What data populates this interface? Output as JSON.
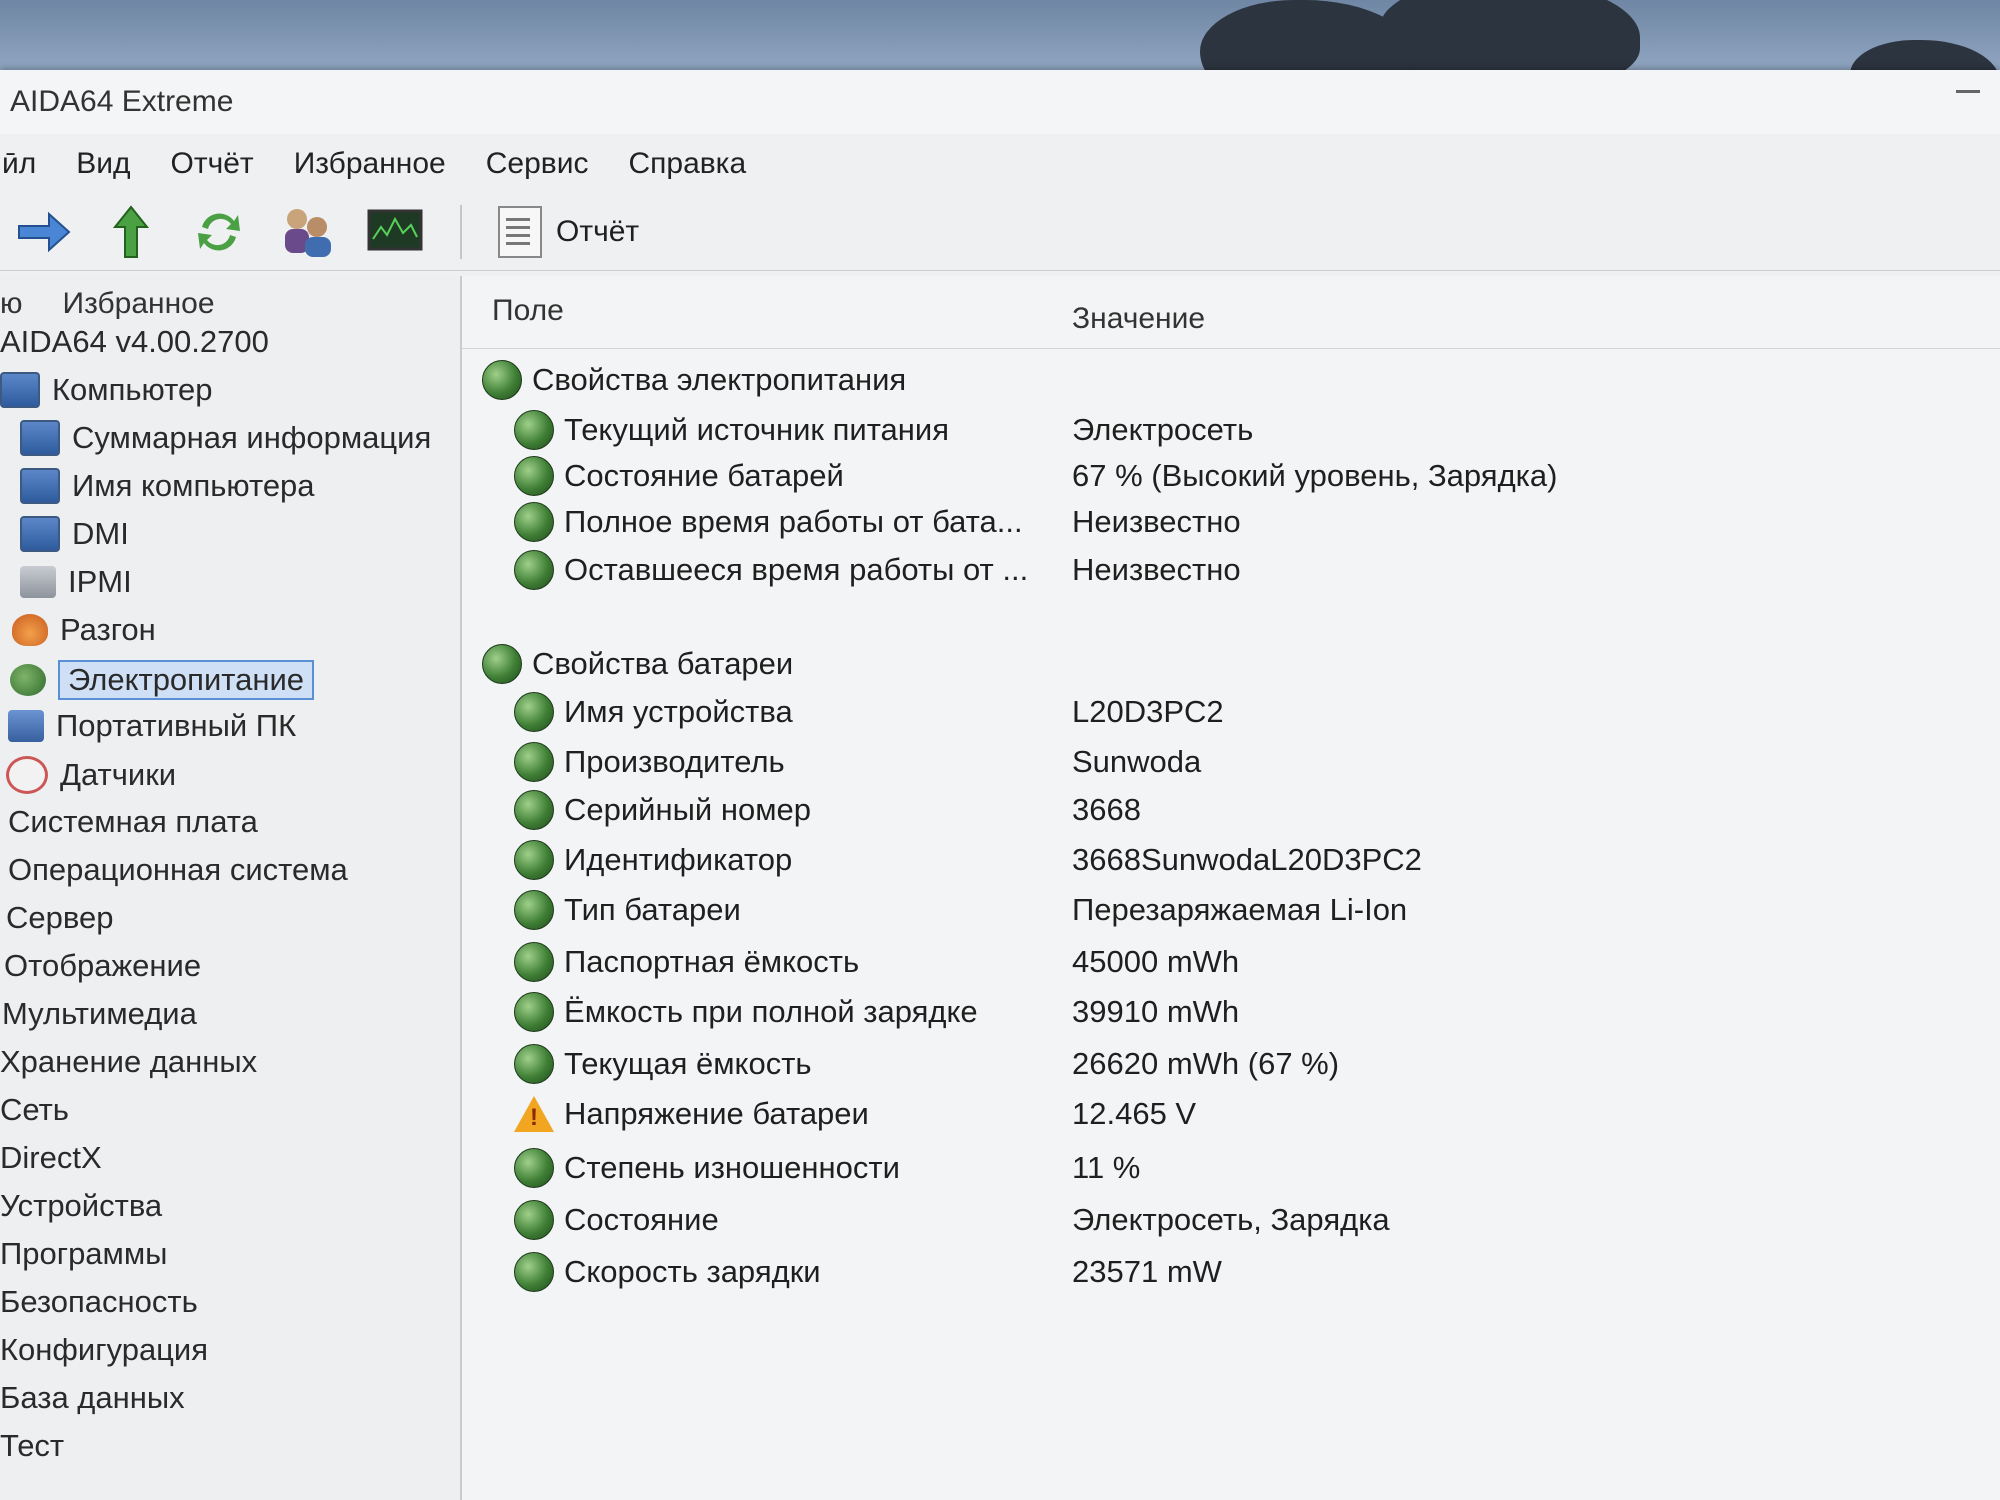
{
  "window": {
    "title": "AIDA64 Extreme"
  },
  "menu": [
    "ӣл",
    "Вид",
    "Отчёт",
    "Избранное",
    "Сервис",
    "Справка"
  ],
  "toolbar": {
    "buttons": [
      "arrow-right-icon",
      "arrow-up-icon",
      "refresh-icon",
      "users-icon",
      "monitor-icon"
    ],
    "report_label": "Отчёт"
  },
  "left_pane": {
    "tabs": [
      "ю",
      "Избранное"
    ],
    "items": [
      {
        "label": "AIDA64 v4.00.2700",
        "icon": ""
      },
      {
        "label": "Компьютер",
        "icon": "monitor"
      },
      {
        "label": "Суммарная информация",
        "icon": "monitor"
      },
      {
        "label": "Имя компьютера",
        "icon": "monitor"
      },
      {
        "label": "DMI",
        "icon": "monitor"
      },
      {
        "label": "IPMI",
        "icon": "server"
      },
      {
        "label": "Разгон",
        "icon": "fire"
      },
      {
        "label": "Электропитание",
        "icon": "power",
        "selected": true
      },
      {
        "label": "Портативный ПК",
        "icon": "laptop"
      },
      {
        "label": "Датчики",
        "icon": "gauge"
      },
      {
        "label": "Системная плата",
        "icon": ""
      },
      {
        "label": "Операционная система",
        "icon": ""
      },
      {
        "label": "Сервер",
        "icon": ""
      },
      {
        "label": "Отображение",
        "icon": ""
      },
      {
        "label": "Мультимедиа",
        "icon": ""
      },
      {
        "label": "Хранение данных",
        "icon": ""
      },
      {
        "label": "Сеть",
        "icon": ""
      },
      {
        "label": "DirectX",
        "icon": ""
      },
      {
        "label": "Устройства",
        "icon": ""
      },
      {
        "label": "Программы",
        "icon": ""
      },
      {
        "label": "Безопасность",
        "icon": ""
      },
      {
        "label": "Конфигурация",
        "icon": ""
      },
      {
        "label": "База данных",
        "icon": ""
      },
      {
        "label": "Тест",
        "icon": ""
      }
    ]
  },
  "table": {
    "columns": [
      "Поле",
      "Значение"
    ],
    "rows": [
      {
        "field": "Свойства электропитания",
        "value": "",
        "icon": "power",
        "group": true
      },
      {
        "field": "Текущий источник питания",
        "value": "Электросеть",
        "icon": "power"
      },
      {
        "field": "Состояние батарей",
        "value": "67 % (Высокий уровень, Зарядка)",
        "icon": "power"
      },
      {
        "field": "Полное время работы от бата...",
        "value": "Неизвестно",
        "icon": "power"
      },
      {
        "field": "Оставшееся время работы от ...",
        "value": "Неизвестно",
        "icon": "power"
      },
      {
        "field": "Свойства батареи",
        "value": "",
        "icon": "power",
        "group": true
      },
      {
        "field": "Имя устройства",
        "value": "L20D3PC2",
        "icon": "power"
      },
      {
        "field": "Производитель",
        "value": "Sunwoda",
        "icon": "power"
      },
      {
        "field": "Серийный номер",
        "value": "3668",
        "icon": "power"
      },
      {
        "field": "Идентификатор",
        "value": "3668SunwodaL20D3PC2",
        "icon": "power"
      },
      {
        "field": "Тип батареи",
        "value": "Перезаряжаемая Li-Ion",
        "icon": "power"
      },
      {
        "field": "Паспортная ёмкость",
        "value": "45000 mWh",
        "icon": "power"
      },
      {
        "field": "Ёмкость при полной зарядке",
        "value": "39910 mWh",
        "icon": "power"
      },
      {
        "field": "Текущая ёмкость",
        "value": "26620 mWh  (67 %)",
        "icon": "power"
      },
      {
        "field": "Напряжение батареи",
        "value": "12.465 V",
        "icon": "warning"
      },
      {
        "field": "Степень изношенности",
        "value": "11 %",
        "icon": "power"
      },
      {
        "field": "Состояние",
        "value": "Электросеть, Зарядка",
        "icon": "power"
      },
      {
        "field": "Скорость зарядки",
        "value": "23571 mW",
        "icon": "power"
      }
    ]
  }
}
